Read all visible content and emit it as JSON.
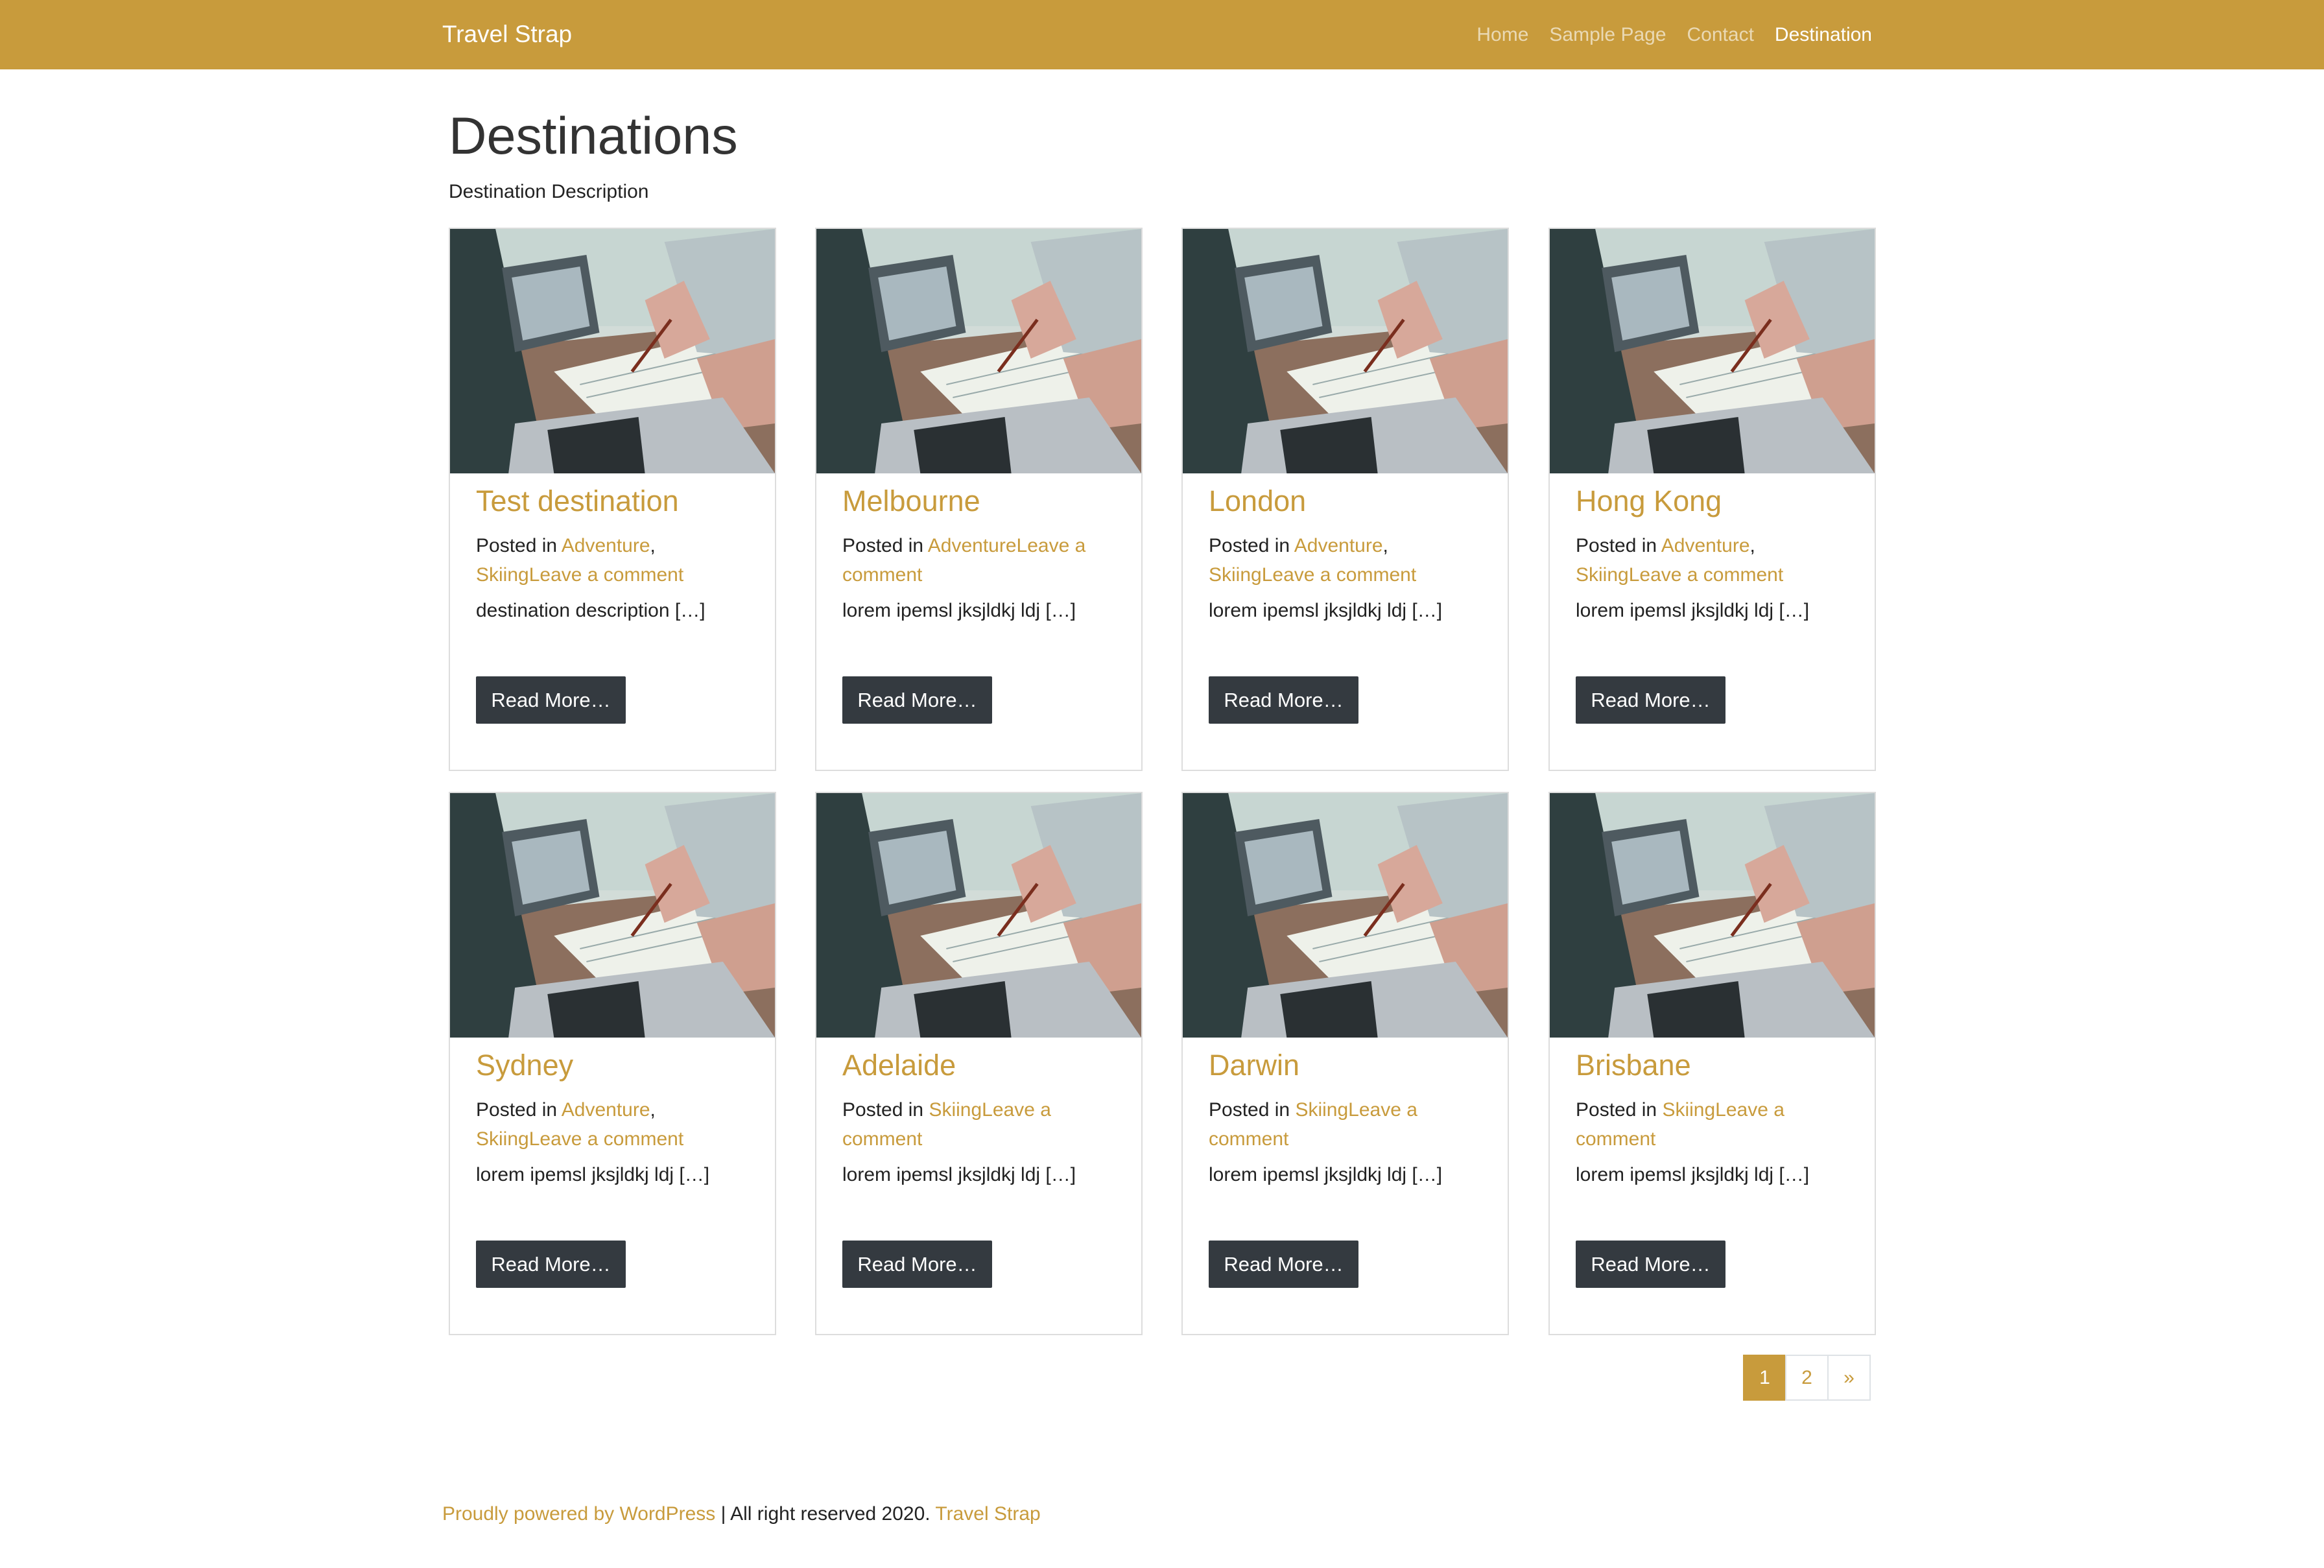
{
  "site": {
    "brand": "Travel Strap"
  },
  "nav": {
    "items": [
      {
        "label": "Home"
      },
      {
        "label": "Sample Page"
      },
      {
        "label": "Contact"
      },
      {
        "label": "Destination",
        "active": true
      }
    ]
  },
  "page": {
    "title": "Destinations",
    "description": "Destination Description"
  },
  "posted_in_label": "Posted in",
  "read_more_label": "Read More…",
  "posts": [
    {
      "title": "Test destination",
      "cats": [
        "Adventure",
        "Skiing"
      ],
      "comment": "Leave a comment",
      "excerpt": "destination description […]"
    },
    {
      "title": "Melbourne",
      "cats": [
        "Adventure"
      ],
      "comment": "Leave a comment",
      "excerpt": "lorem ipemsl jksjldkj ldj […]"
    },
    {
      "title": "London",
      "cats": [
        "Adventure",
        "Skiing"
      ],
      "comment": "Leave a comment",
      "excerpt": "lorem ipemsl jksjldkj ldj […]"
    },
    {
      "title": "Hong Kong",
      "cats": [
        "Adventure",
        "Skiing"
      ],
      "comment": "Leave a comment",
      "excerpt": "lorem ipemsl jksjldkj ldj […]"
    },
    {
      "title": "Sydney",
      "cats": [
        "Adventure",
        "Skiing"
      ],
      "comment": "Leave a comment",
      "excerpt": "lorem ipemsl jksjldkj ldj […]"
    },
    {
      "title": "Adelaide",
      "cats": [
        "Skiing"
      ],
      "comment": "Leave a comment",
      "excerpt": "lorem ipemsl jksjldkj ldj […]"
    },
    {
      "title": "Darwin",
      "cats": [
        "Skiing"
      ],
      "comment": "Leave a comment",
      "excerpt": "lorem ipemsl jksjldkj ldj […]"
    },
    {
      "title": "Brisbane",
      "cats": [
        "Skiing"
      ],
      "comment": "Leave a comment",
      "excerpt": "lorem ipemsl jksjldkj ldj […]"
    }
  ],
  "pagination": {
    "pages": [
      "1",
      "2"
    ],
    "current": "1",
    "next": "»"
  },
  "footer": {
    "powered": "Proudly powered by WordPress",
    "sep": " | All right reserved 2020. ",
    "site_link": "Travel Strap"
  },
  "colors": {
    "accent": "#c89b3c",
    "button": "#343a40",
    "nav_inactive": "rgba(255,255,255,0.62)"
  }
}
